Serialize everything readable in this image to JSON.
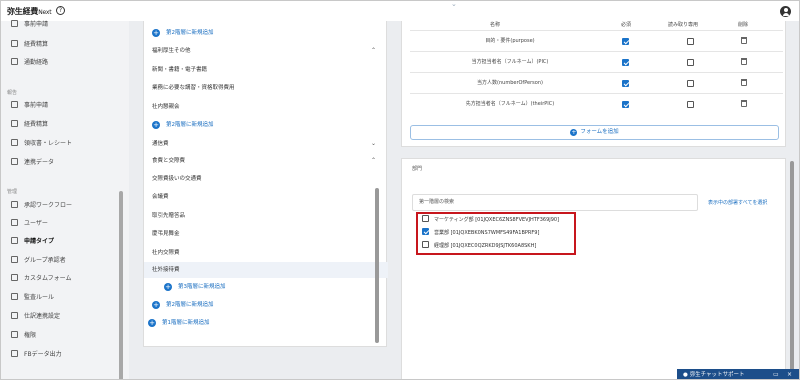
{
  "header": {
    "app_title": "弥生経費",
    "app_suffix": "Next",
    "help_icon": "?",
    "top_chevron": "⌄"
  },
  "sidebar": {
    "items": [
      {
        "label": "事前申請",
        "icon": "document-icon"
      },
      {
        "label": "経費精算",
        "icon": "receipt-icon"
      },
      {
        "label": "通勤経路",
        "icon": "route-icon"
      }
    ],
    "section_report": "報告",
    "report_items": [
      {
        "label": "事前申請"
      },
      {
        "label": "経費精算"
      },
      {
        "label": "領収書・レシート"
      },
      {
        "label": "連携データ"
      }
    ],
    "section_admin": "管理",
    "admin_items": [
      {
        "label": "承認ワークフロー"
      },
      {
        "label": "ユーザー"
      },
      {
        "label": "申請タイプ",
        "active": true
      },
      {
        "label": "グループ承認者"
      },
      {
        "label": "カスタムフォーム"
      },
      {
        "label": "監査ルール"
      },
      {
        "label": "仕訳連携設定"
      },
      {
        "label": "権限"
      },
      {
        "label": "FBデータ出力"
      }
    ]
  },
  "categories": {
    "add_level2_top": "第2階層に新規追加",
    "welfare_header": "福利厚生その他",
    "welfare_items": [
      "新聞・書籍・電子書籍",
      "業務に必要な講習・資格取得費用",
      "社内懇親会"
    ],
    "add_level2_welfare": "第2階層に新規追加",
    "comm_header": "通信費",
    "food_header": "食費と交際費",
    "food_items": [
      "交際費扱いの交通費",
      "会議費",
      "取引先贈答品",
      "慶弔見舞金",
      "社内交際費",
      "社外接待費"
    ],
    "add_level3": "第3階層に新規追加",
    "add_level2_food": "第2階層に新規追加",
    "add_level1": "第1階層に新規追加"
  },
  "fields_table": {
    "headers": {
      "name": "名称",
      "required": "必須",
      "readonly": "読み取り専用",
      "delete": "削除"
    },
    "rows": [
      {
        "name": "目的・要件(purpose)",
        "required": true,
        "readonly": false
      },
      {
        "name": "当方担当者名（フルネーム）(PIC)",
        "required": true,
        "readonly": false
      },
      {
        "name": "当方人数(numberOfPerson)",
        "required": true,
        "readonly": false
      },
      {
        "name": "先方担当者名（フルネーム）(theirPIC)",
        "required": true,
        "readonly": false
      }
    ],
    "add_form": "フォームを追加"
  },
  "department": {
    "label": "部門",
    "search_placeholder": "第一階層の検索",
    "select_all": "表示中の部署すべてを選択",
    "options": [
      {
        "label": "マーケティング部 [01JQXEC6ZNS8FVEVJHTF369J90]",
        "checked": false
      },
      {
        "label": "営業部 [01JQXEBK0NS7WMFS49FA1BPRF9]",
        "checked": true
      },
      {
        "label": "経理部 [01JQXEC0QZRKD9JSJTK60A8SKH]",
        "checked": false
      }
    ]
  },
  "chat": {
    "label": "弥生チャットサポート",
    "minimize": "▭",
    "close": "×"
  },
  "colors": {
    "accent": "#1a73c9",
    "highlight_box": "#c7161d",
    "chat_bar": "#1c4e8a"
  }
}
